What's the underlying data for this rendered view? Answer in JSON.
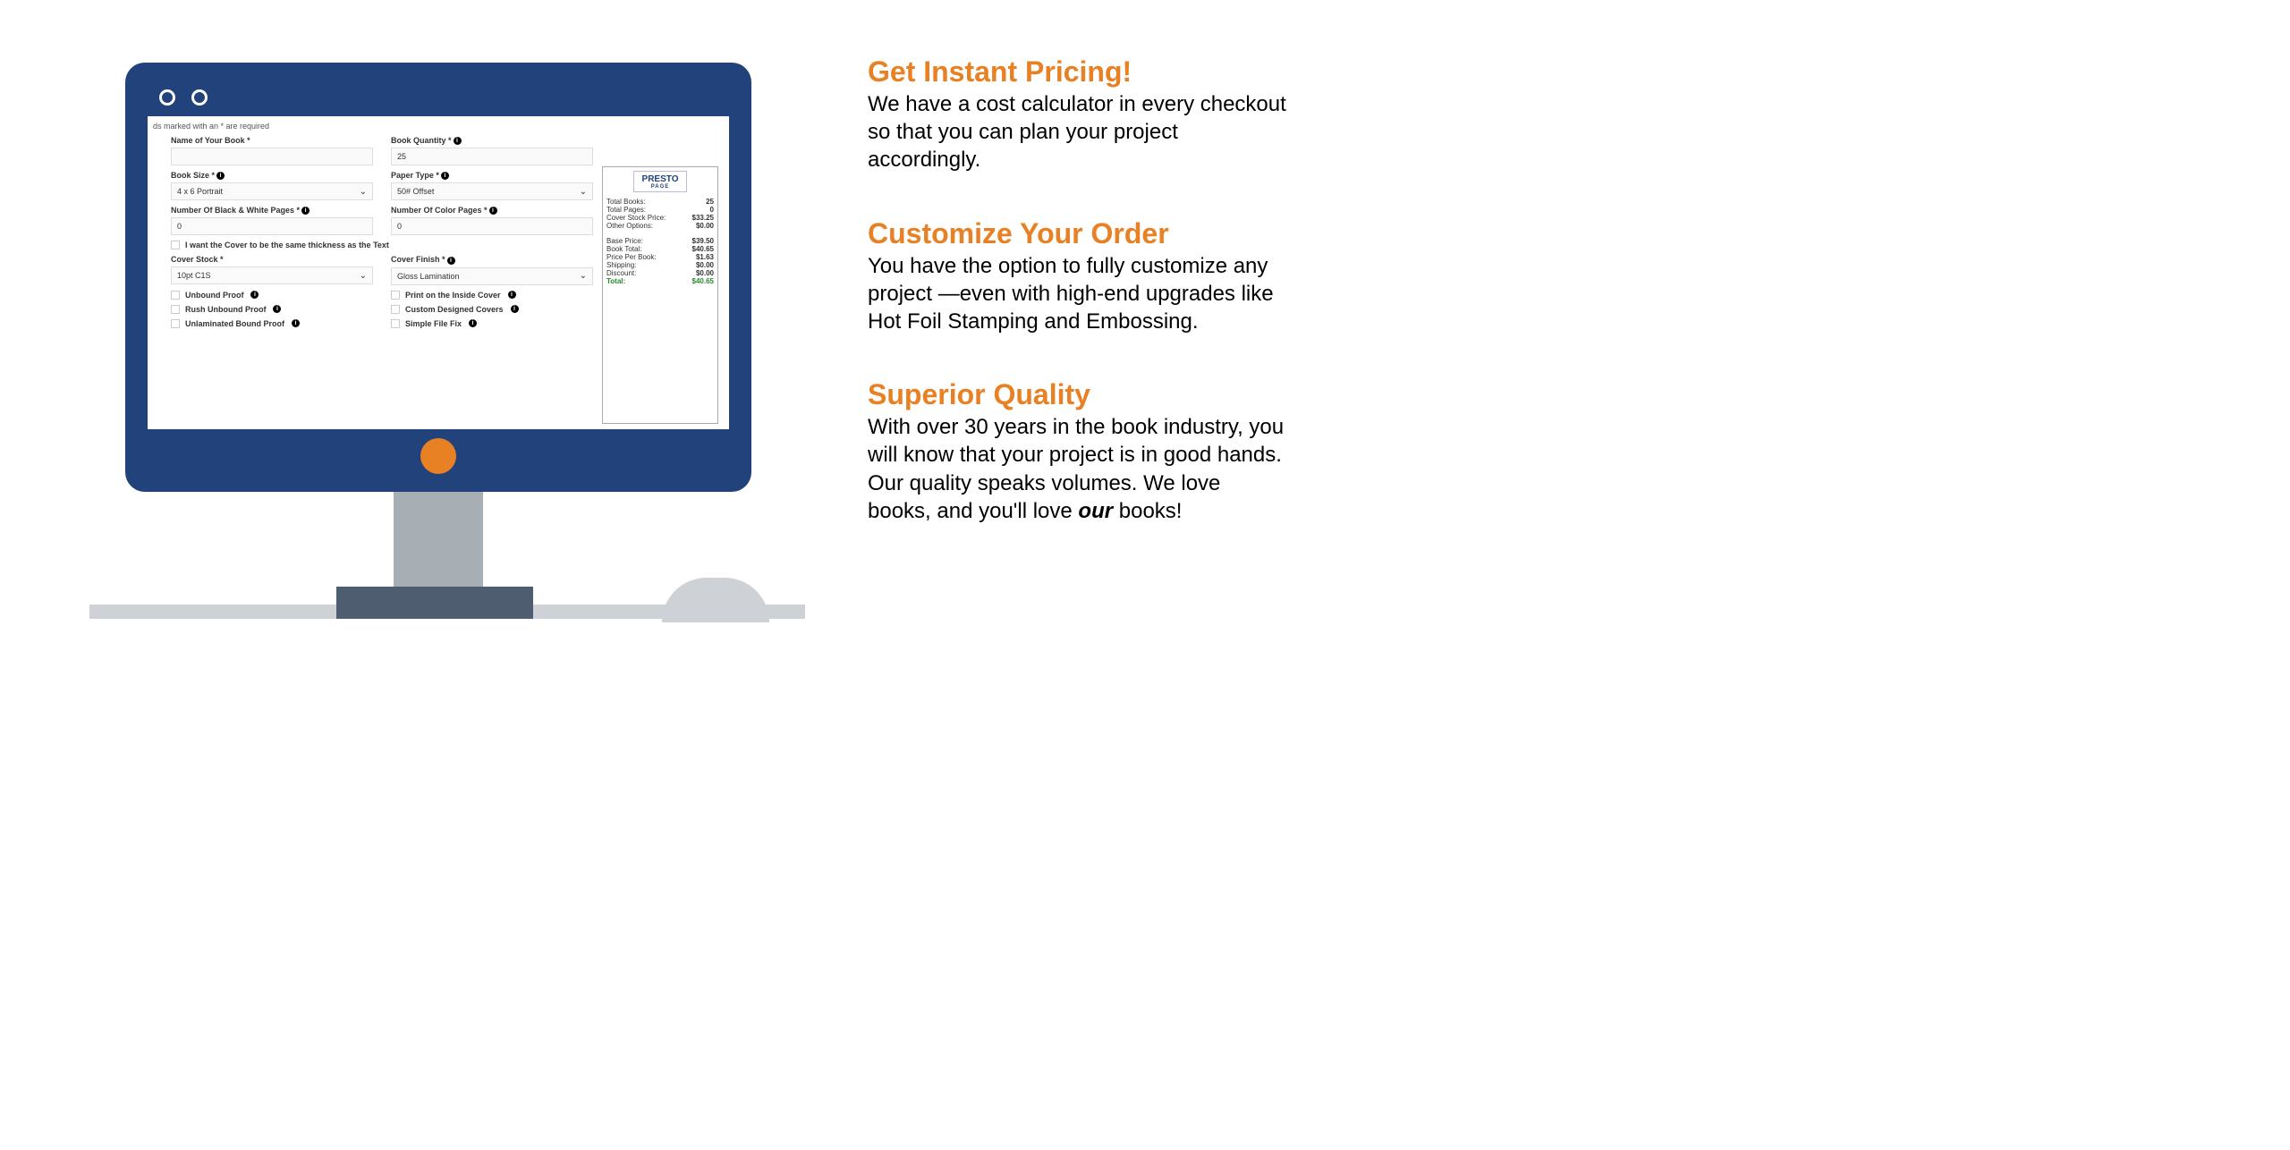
{
  "form": {
    "required_note": "ds marked with an * are required",
    "fields": {
      "name": {
        "label": "Name of Your Book *"
      },
      "quantity": {
        "label": "Book Quantity *",
        "value": "25"
      },
      "size": {
        "label": "Book Size *",
        "value": "4 x 6 Portrait"
      },
      "paper": {
        "label": "Paper Type *",
        "value": "50# Offset"
      },
      "bw_pages": {
        "label": "Number Of Black & White Pages *",
        "value": "0"
      },
      "color_pages": {
        "label": "Number Of Color Pages *",
        "value": "0"
      },
      "same_thickness": {
        "label": "I want the Cover to be the same thickness as the Text"
      },
      "cover_stock": {
        "label": "Cover Stock *",
        "value": "10pt C1S"
      },
      "cover_finish": {
        "label": "Cover Finish *",
        "value": "Gloss Lamination"
      }
    },
    "options": [
      {
        "label": "Unbound Proof"
      },
      {
        "label": "Print on the Inside Cover"
      },
      {
        "label": "Rush Unbound Proof"
      },
      {
        "label": "Custom Designed Covers"
      },
      {
        "label": "Unlaminated Bound Proof"
      },
      {
        "label": "Simple File Fix"
      }
    ]
  },
  "pricing": {
    "logo_main": "PRESTO",
    "logo_sub": "PAGE",
    "rows": [
      {
        "label": "Total Books:",
        "value": "25"
      },
      {
        "label": "Total Pages:",
        "value": "0"
      },
      {
        "label": "Cover Stock Price:",
        "value": "$33.25"
      },
      {
        "label": "Other Options:",
        "value": "$0.00"
      }
    ],
    "rows2": [
      {
        "label": "Base Price:",
        "value": "$39.50"
      },
      {
        "label": "Book Total:",
        "value": "$40.65"
      },
      {
        "label": "Price Per Book:",
        "value": "$1.63"
      },
      {
        "label": "Shipping:",
        "value": "$0.00"
      },
      {
        "label": "Discount:",
        "value": "$0.00"
      }
    ],
    "total": {
      "label": "Total:",
      "value": "$40.65"
    }
  },
  "features": [
    {
      "title": "Get Instant Pricing!",
      "body": "We have a cost calculator in every checkout so that you can plan your project accordingly."
    },
    {
      "title": "Customize Your Order",
      "body": "You have the option to fully customize any project —even with high-end upgrades like Hot Foil Stamping and Embossing."
    },
    {
      "title": "Superior Quality",
      "body_pre": "With over 30 years in the book industry, you will know that your project is in good hands. Our quality speaks volumes. We love books, and you'll love ",
      "body_em": "our",
      "body_post": " books!"
    }
  ]
}
